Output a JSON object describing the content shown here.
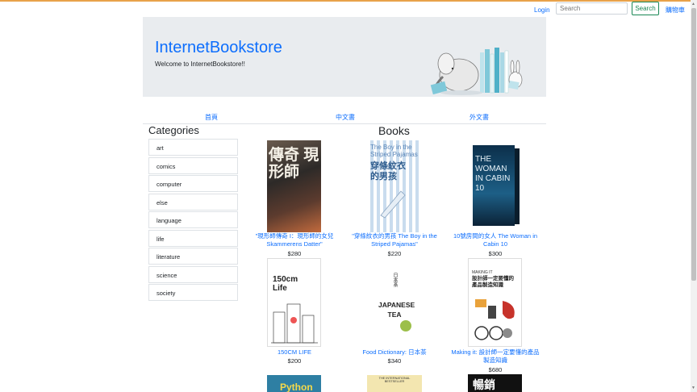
{
  "header": {
    "login_label": "Login",
    "search_placeholder": "Search",
    "search_button": "Search",
    "cart_label": "購物車"
  },
  "hero": {
    "title": "InternetBookstore",
    "subtitle": "Welcome to InternetBookstore!!"
  },
  "nav": {
    "items": [
      {
        "label": "首頁"
      },
      {
        "label": "中文書"
      },
      {
        "label": "外文書"
      }
    ]
  },
  "categories": {
    "title": "Categories",
    "items": [
      "art",
      "comics",
      "computer",
      "else",
      "language",
      "life",
      "literature",
      "science",
      "society"
    ]
  },
  "books": {
    "title": "Books",
    "items": [
      {
        "title": "\"現形師傳奇 I：現形師的女兒 Skammerens Datter\"",
        "price": "$280"
      },
      {
        "title": "\"穿條紋衣的男孩 The Boy in the Striped Pajamas\"",
        "price": "$220"
      },
      {
        "title": "10號房間的女人 The Woman in Cabin 10",
        "price": "$300"
      },
      {
        "title": "150CM LIFE",
        "price": "$200"
      },
      {
        "title": "Food Dictionary: 日本茶",
        "price": "$340"
      },
      {
        "title": "Making it: 設計師一定要懂的產品製造知識",
        "price": "$680"
      }
    ],
    "cover_text": {
      "b1_title": "傳奇 現形師",
      "b2_title_en": "The Boy in the Striped Pajamas",
      "b2_title_zh": "穿條紋衣的男孩",
      "b3_title": "THE WOMAN IN CABIN 10",
      "b4_title": "150cm Life",
      "b5_title": "JAPANESE TEA",
      "b5_sub": "日本茶",
      "b6_title": "MAKING IT",
      "b6_sub": "設計師一定要懂的產品製造知識",
      "b7_title": "Python",
      "b8_title": "THE INTERNATIONAL BESTSELLER",
      "b9_title": "暢銷"
    }
  },
  "colors": {
    "link": "#0d6efd",
    "hero_bg": "#e9ecef",
    "search_button": "#198754",
    "top_accent": "#e8a24a"
  }
}
